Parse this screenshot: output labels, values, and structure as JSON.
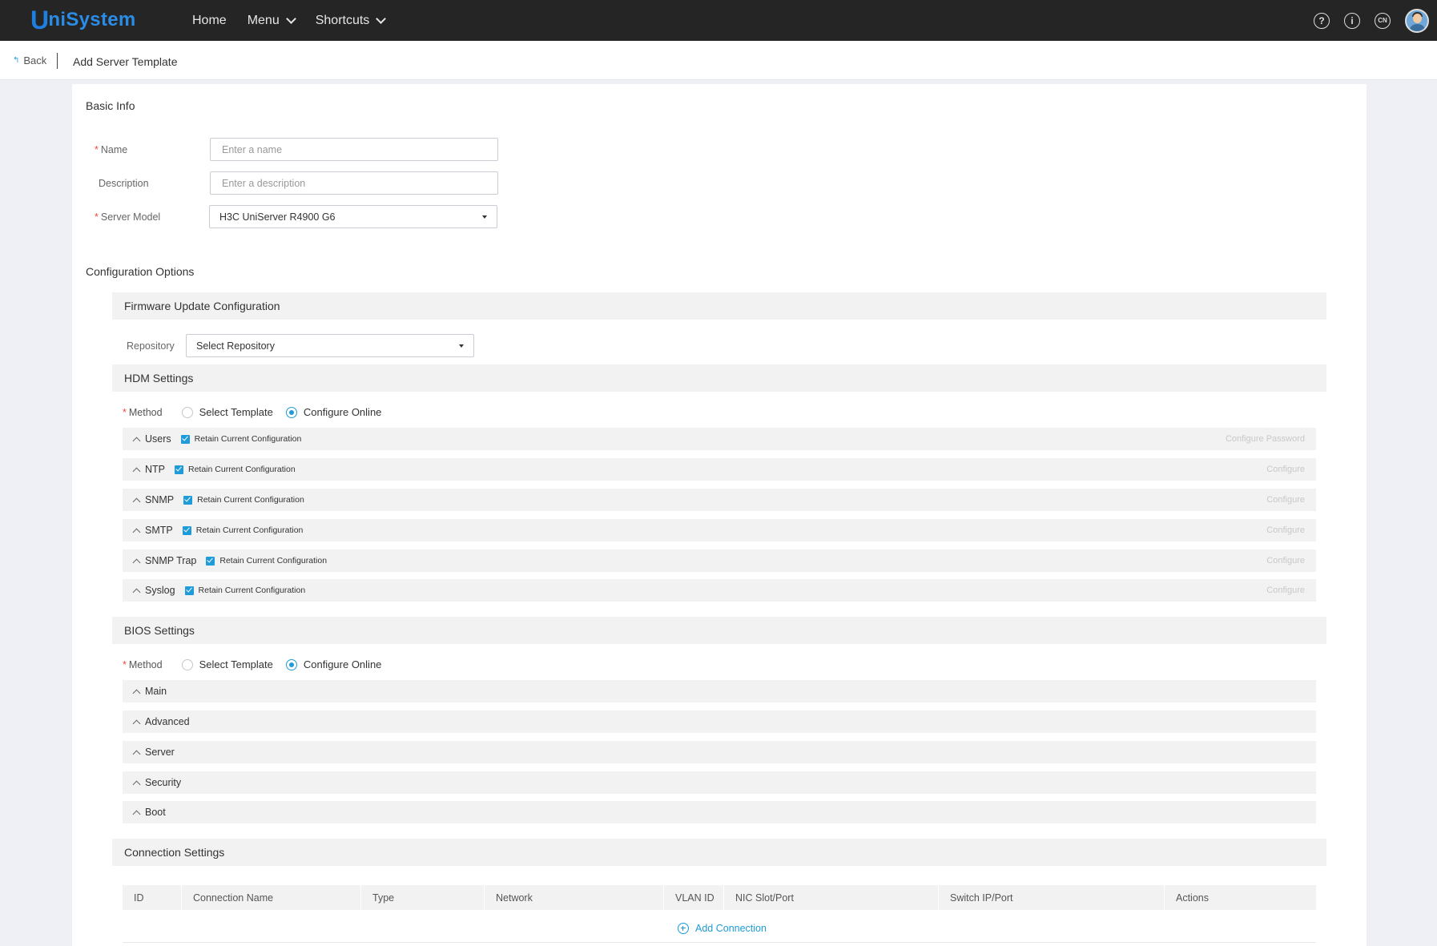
{
  "app": {
    "logo_u": "U",
    "logo_rest": "niSystem"
  },
  "nav": {
    "home": "Home",
    "menu": "Menu",
    "shortcuts": "Shortcuts"
  },
  "top_icons": {
    "help": "?",
    "info": "i",
    "lang": "CN"
  },
  "subheader": {
    "back": "Back",
    "title": "Add Server Template"
  },
  "basic_info": {
    "title": "Basic Info",
    "name_label": "Name",
    "name_placeholder": "Enter a name",
    "desc_label": "Description",
    "desc_placeholder": "Enter a description",
    "model_label": "Server Model",
    "model_value": "H3C UniServer R4900 G6"
  },
  "config": {
    "title": "Configuration Options",
    "firmware": {
      "title": "Firmware Update Configuration",
      "repo_label": "Repository",
      "repo_value": "Select Repository"
    },
    "hdm": {
      "title": "HDM Settings",
      "method_label": "Method",
      "opt_template": "Select Template",
      "opt_online": "Configure Online",
      "retain": "Retain Current Configuration",
      "items": [
        {
          "label": "Users",
          "action": "Configure Password"
        },
        {
          "label": "NTP",
          "action": "Configure"
        },
        {
          "label": "SNMP",
          "action": "Configure"
        },
        {
          "label": "SMTP",
          "action": "Configure"
        },
        {
          "label": "SNMP Trap",
          "action": "Configure"
        },
        {
          "label": "Syslog",
          "action": "Configure"
        }
      ]
    },
    "bios": {
      "title": "BIOS Settings",
      "method_label": "Method",
      "opt_template": "Select Template",
      "opt_online": "Configure Online",
      "items": [
        "Main",
        "Advanced",
        "Server",
        "Security",
        "Boot"
      ]
    },
    "connection": {
      "title": "Connection Settings",
      "columns": [
        "ID",
        "Connection Name",
        "Type",
        "Network",
        "VLAN ID",
        "NIC Slot/Port",
        "Switch IP/Port",
        "Actions"
      ],
      "add_label": "Add Connection"
    }
  },
  "colors": {
    "accent": "#1e9bd8",
    "topbar": "#252525",
    "required": "#e84c3d"
  }
}
